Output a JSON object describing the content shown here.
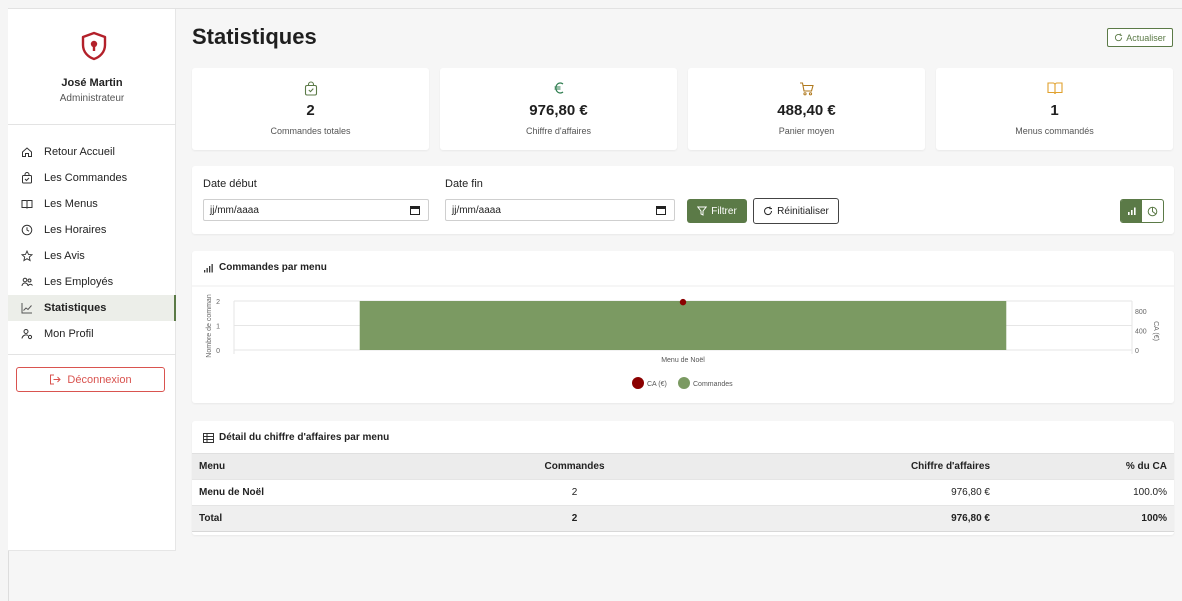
{
  "sidebar": {
    "user_name": "José Martin",
    "user_role": "Administrateur",
    "items": [
      {
        "label": "Retour Accueil",
        "icon": "home-icon"
      },
      {
        "label": "Les Commandes",
        "icon": "shopping-bag-icon"
      },
      {
        "label": "Les Menus",
        "icon": "book-icon"
      },
      {
        "label": "Les Horaires",
        "icon": "clock-icon"
      },
      {
        "label": "Les Avis",
        "icon": "star-icon"
      },
      {
        "label": "Les Employés",
        "icon": "users-icon"
      },
      {
        "label": "Statistiques",
        "icon": "chart-line-icon",
        "active": true
      },
      {
        "label": "Mon Profil",
        "icon": "user-gear-icon"
      }
    ],
    "logout_label": "Déconnexion"
  },
  "header": {
    "title": "Statistiques",
    "refresh_label": "Actualiser"
  },
  "stats": [
    {
      "value": "2",
      "label": "Commandes totales",
      "icon": "shopping-bag-icon",
      "color": "#5b7a47"
    },
    {
      "value": "976,80 €",
      "label": "Chiffre d'affaires",
      "icon": "euro-icon",
      "color": "#2e7d4f"
    },
    {
      "value": "488,40 €",
      "label": "Panier moyen",
      "icon": "cart-icon",
      "color": "#b07a1f"
    },
    {
      "value": "1",
      "label": "Menus commandés",
      "icon": "book-open-icon",
      "color": "#e0a02c"
    }
  ],
  "filters": {
    "start_label": "Date début",
    "end_label": "Date fin",
    "start_value": "jj/mm/aaaa",
    "end_value": "jj/mm/aaaa",
    "filter_label": "Filtrer",
    "reset_label": "Réinitialiser"
  },
  "chart_card": {
    "title": "Commandes par menu"
  },
  "chart_data": {
    "type": "bar",
    "categories": [
      "Menu de Noël"
    ],
    "series": [
      {
        "name": "Commandes",
        "type": "bar",
        "axis": "left",
        "values": [
          2
        ],
        "color": "#7b9a62"
      },
      {
        "name": "CA (€)",
        "type": "line",
        "axis": "right",
        "values": [
          976.8
        ],
        "color": "#8b0000"
      }
    ],
    "ylabel": "Nombre de comman",
    "y2label": "CA (€)",
    "ylim": [
      0,
      2
    ],
    "y2lim": [
      0,
      1000
    ],
    "yticks": [
      "2",
      "1",
      "0"
    ],
    "y2ticks": [
      "800",
      "400",
      "0"
    ],
    "legend_position": "bottom"
  },
  "table": {
    "title": "Détail du chiffre d'affaires par menu",
    "headers": [
      "Menu",
      "Commandes",
      "Chiffre d'affaires",
      "% du CA"
    ],
    "rows": [
      [
        "Menu de Noël",
        "2",
        "976,80 €",
        "100.0%"
      ]
    ],
    "total": [
      "Total",
      "2",
      "976,80 €",
      "100%"
    ]
  },
  "colors": {
    "accent": "#5b7a47",
    "danger": "#d9534f",
    "logo": "#b3202a"
  }
}
